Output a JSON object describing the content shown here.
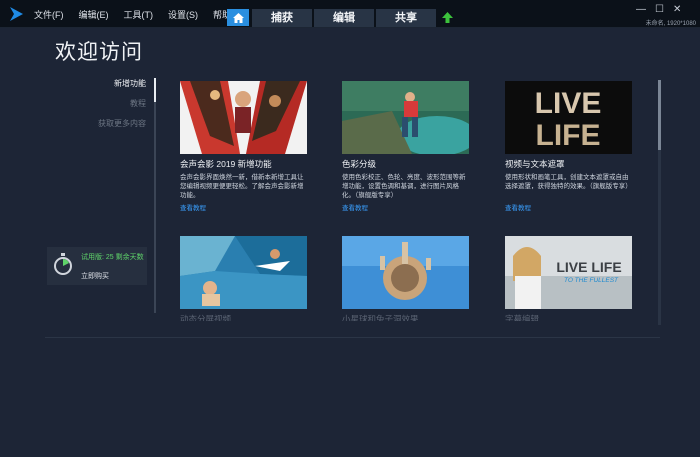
{
  "menu": {
    "items": [
      "文件(F)",
      "编辑(E)",
      "工具(T)",
      "设置(S)",
      "帮助(H)"
    ]
  },
  "tabs": [
    "捕获",
    "编辑",
    "共享"
  ],
  "window": {
    "minimize": "—",
    "maximize": "☐",
    "close": "✕",
    "info": "未命名, 1920*1080"
  },
  "welcome": {
    "title": "欢迎访问"
  },
  "side_nav": {
    "items": [
      "新增功能",
      "教程",
      "获取更多内容"
    ]
  },
  "trial": {
    "text": "试用版: 25 剩余天数",
    "buy": "立即购买"
  },
  "cards": [
    {
      "title": "会声会影 2019 新增功能",
      "desc": "会声会影界面焕然一新，借新本新增工具让您编辑视频更便更轻松。了解会声会影新增功能。",
      "link": "查看教程"
    },
    {
      "title": "色彩分级",
      "desc": "使用色彩校正、色轮、亮度、波形范围等新增功能，设置色调和基调，进行图片风格化。（旗舰版专享）",
      "link": "查看教程"
    },
    {
      "title": "视频与文本遮罩",
      "desc": "使用形状和画笔工具，创建文本遮罩或自由选择遮罩，获得独特的效果。（旗舰版专享）",
      "link": "查看教程"
    },
    {
      "title": "动态分屏视频",
      "desc": "",
      "link": ""
    },
    {
      "title": "小星球和兔子洞效果",
      "desc": "",
      "link": ""
    },
    {
      "title": "字幕编辑",
      "desc": "",
      "link": ""
    }
  ],
  "thumb_text": {
    "live": "LIVE",
    "life": "LIFE",
    "live_life": "LIVE LIFE",
    "fullest": "TO THE FULLEST"
  },
  "colors": {
    "accent": "#2a8fe0",
    "link": "#3aa0ff",
    "trial": "#5fd46a",
    "panel": "#1d2536"
  }
}
